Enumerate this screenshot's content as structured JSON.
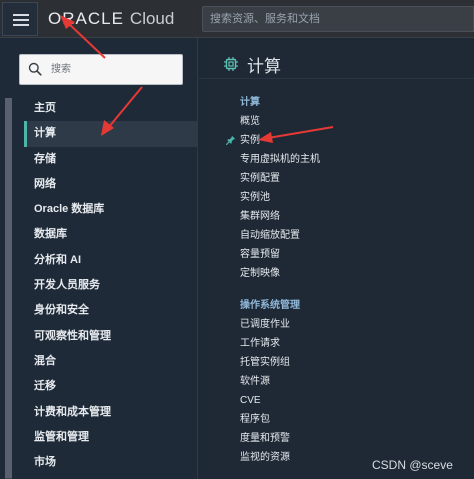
{
  "topbar": {
    "brand_oracle": "ORACLE",
    "brand_cloud": "Cloud",
    "search_placeholder": "搜索资源、服务和文档"
  },
  "sidebar": {
    "search_placeholder": "搜索",
    "items": [
      {
        "label": "主页"
      },
      {
        "label": "计算",
        "active": true
      },
      {
        "label": "存储"
      },
      {
        "label": "网络"
      },
      {
        "label": "Oracle 数据库"
      },
      {
        "label": "数据库"
      },
      {
        "label": "分析和 AI"
      },
      {
        "label": "开发人员服务"
      },
      {
        "label": "身份和安全"
      },
      {
        "label": "可观察性和管理"
      },
      {
        "label": "混合"
      },
      {
        "label": "迁移"
      },
      {
        "label": "计费和成本管理"
      },
      {
        "label": "监管和管理"
      },
      {
        "label": "市场"
      }
    ]
  },
  "detail": {
    "title": "计算",
    "sections": [
      {
        "header": "计算",
        "items": [
          "概览",
          "实例",
          "专用虚拟机的主机",
          "实例配置",
          "实例池",
          "集群网络",
          "自动缩放配置",
          "容量预留",
          "定制映像"
        ]
      },
      {
        "header": "操作系统管理",
        "items": [
          "已调度作业",
          "工作请求",
          "托管实例组",
          "软件源",
          "CVE",
          "程序包",
          "度量和预警",
          "监视的资源"
        ]
      }
    ]
  },
  "watermark": "CSDN @sceve",
  "colors": {
    "accent_teal": "#4fb5a8",
    "section_header": "#8fb7d8",
    "arrow_red": "#e53935"
  }
}
